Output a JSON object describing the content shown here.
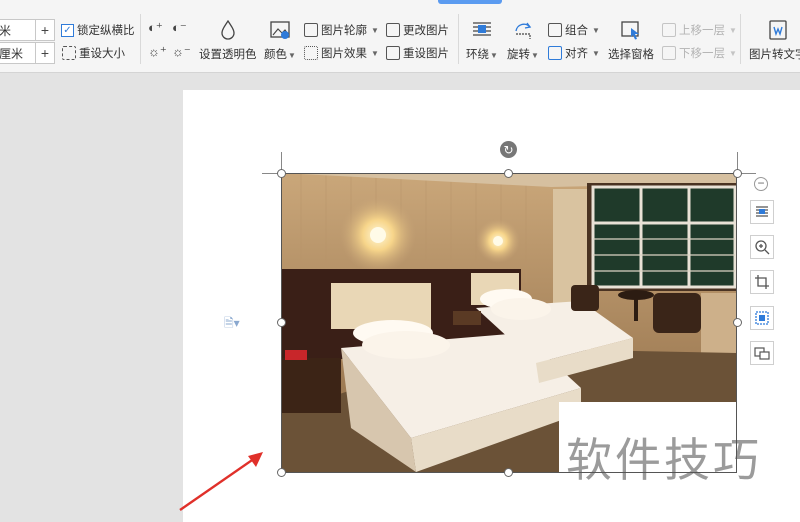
{
  "toolbar": {
    "width_unit": "米",
    "height_unit": "厘米",
    "plus": "+",
    "lock_ratio_label": "锁定纵横比",
    "reset_size_label": "重设大小",
    "set_transparent_label": "设置透明色",
    "color_label": "颜色",
    "picture_outline_label": "图片轮廓",
    "picture_effect_label": "图片效果",
    "change_picture_label": "更改图片",
    "reset_picture_label": "重设图片",
    "wrap_label": "环绕",
    "rotate_label": "旋转",
    "group_label": "组合",
    "align_label": "对齐",
    "selection_pane_label": "选择窗格",
    "bring_forward_label": "上移一层",
    "send_backward_label": "下移一层",
    "picture_to_text_label": "图片转文字"
  },
  "watermark": {
    "text": "软件技巧"
  },
  "colors": {
    "accent": "#2f7bd9",
    "arrow": "#e0302a"
  }
}
